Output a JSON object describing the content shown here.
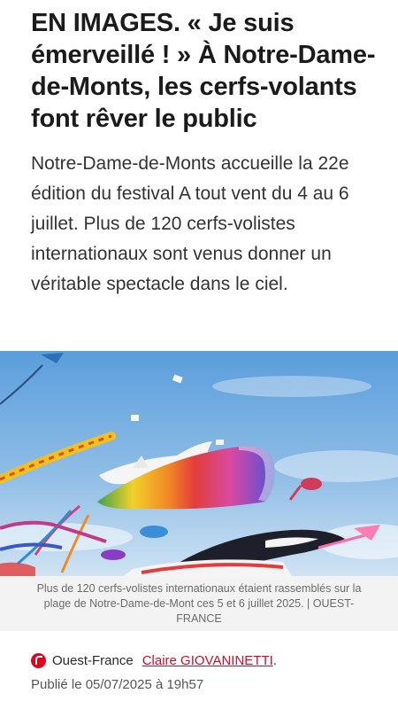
{
  "article": {
    "headline": "EN IMAGES. « Je suis émerveillé ! » À Notre-Dame-de-Monts, les cerfs-volants font rêver le public",
    "lead": "Notre-Dame-de-Monts accueille la 22e édition du festival A tout vent du 4 au 6 juillet. Plus de 120 cerfs-volistes internationaux sont venus donner un véritable spectacle dans le ciel.",
    "photo_caption": "Plus de 120 cerfs-volistes internationaux étaient rassemblés sur la plage de Notre-Dame-de-Mont ces 5 et 6 juillet 2025. | OUEST-FRANCE",
    "source": "Ouest-France",
    "author": "Claire GIOVANINETTI",
    "author_suffix": ".",
    "published": "Publié le 05/07/2025 à 19h57"
  },
  "colors": {
    "brand": "#e2001a",
    "link": "#c8102e",
    "sky_top": "#5b9fdd",
    "sky_bottom": "#c6def2"
  }
}
